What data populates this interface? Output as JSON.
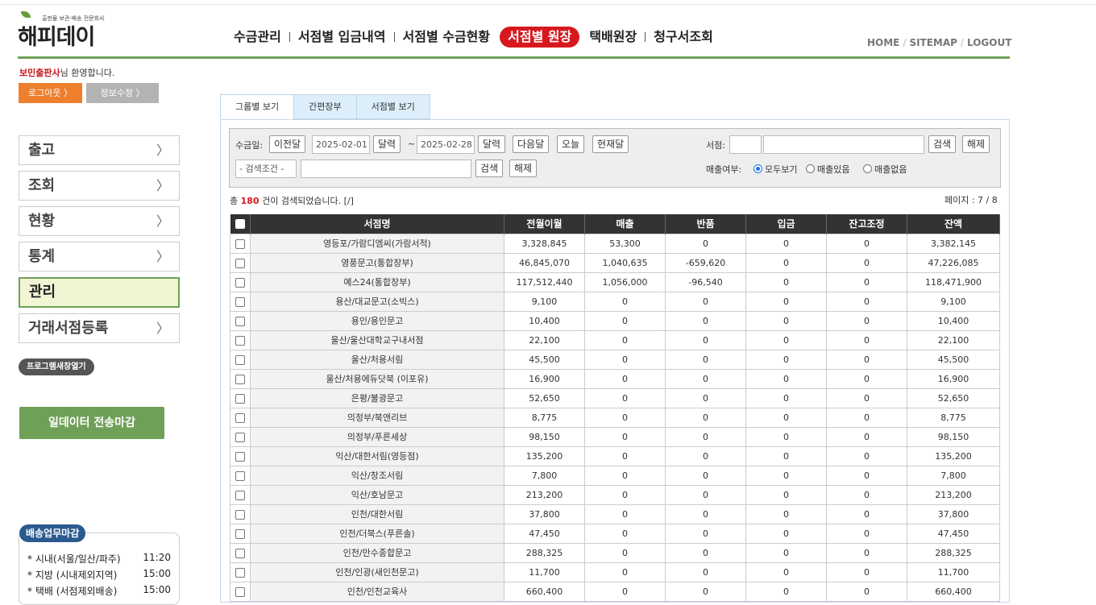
{
  "logo": {
    "subtitle": "출판물 보관·배송 전문회사",
    "name": "해피데이"
  },
  "nav": {
    "items": [
      "수금관리",
      "서점별 입금내역",
      "서점별 수금현황",
      "서점별 원장",
      "택배원장",
      "청구서조회"
    ],
    "active_index": 3
  },
  "util": {
    "home": "HOME",
    "sitemap": "SITEMAP",
    "logout": "LOGOUT"
  },
  "user": {
    "name": "보민출판사",
    "suffix": "님 환영합니다.",
    "logout_btn": "로그아웃 〉",
    "info_btn": "정보수정 〉"
  },
  "sidebar": {
    "items": [
      "출고",
      "조회",
      "현황",
      "통계",
      "관리",
      "거래서점등록"
    ],
    "active_index": 4,
    "program_btn": "프로그램새창열기",
    "close_btn": "일데이터 전송마감"
  },
  "shipping": {
    "title": "배송업무마감",
    "rows": [
      {
        "label": "* 시내(서울/일산/파주)",
        "time": "11:20"
      },
      {
        "label": "* 지방 (시내제외지역)",
        "time": "15:00"
      },
      {
        "label": "* 택배 (서점제외배송)",
        "time": "15:00"
      }
    ]
  },
  "tabs": [
    "그룹별 보기",
    "간편장부",
    "서점별 보기"
  ],
  "search": {
    "date_label": "수금일:",
    "prev_btn": "이전달",
    "from": "2025-02-01",
    "cal_btn": "달력",
    "tilde": "~",
    "to": "2025-02-28",
    "next_btn": "다음달",
    "today_btn": "오늘",
    "current_btn": "현재달",
    "store_label": "서점:",
    "search_btn": "검색",
    "reset_btn": "해제",
    "cond_label": "- 검색조건 -",
    "sales_label": "매출여부:",
    "radios": [
      "모두보기",
      "매출있음",
      "매출없음"
    ],
    "radio_selected": 0
  },
  "result": {
    "prefix": "총",
    "count": "180",
    "suffix": "건이 검색되었습니다. [/]",
    "page": "페이지 : 7 / 8"
  },
  "table": {
    "headers": [
      "서점명",
      "전월이월",
      "매출",
      "반품",
      "입금",
      "잔고조정",
      "잔액"
    ],
    "rows": [
      [
        "영등포/가람디엠씨(가람서적)",
        "3,328,845",
        "53,300",
        "0",
        "0",
        "0",
        "3,382,145"
      ],
      [
        "영풍문고(통합장부)",
        "46,845,070",
        "1,040,635",
        "-659,620",
        "0",
        "0",
        "47,226,085"
      ],
      [
        "예스24(통합장부)",
        "117,512,440",
        "1,056,000",
        "-96,540",
        "0",
        "0",
        "118,471,900"
      ],
      [
        "용산/대교문고(소빅스)",
        "9,100",
        "0",
        "0",
        "0",
        "0",
        "9,100"
      ],
      [
        "용인/용인문고",
        "10,400",
        "0",
        "0",
        "0",
        "0",
        "10,400"
      ],
      [
        "울산/울산대학교구내서점",
        "22,100",
        "0",
        "0",
        "0",
        "0",
        "22,100"
      ],
      [
        "울산/처용서림",
        "45,500",
        "0",
        "0",
        "0",
        "0",
        "45,500"
      ],
      [
        "울산/처용에듀닷북 (이포유)",
        "16,900",
        "0",
        "0",
        "0",
        "0",
        "16,900"
      ],
      [
        "은평/불광문고",
        "52,650",
        "0",
        "0",
        "0",
        "0",
        "52,650"
      ],
      [
        "의정부/북앤리브",
        "8,775",
        "0",
        "0",
        "0",
        "0",
        "8,775"
      ],
      [
        "의정부/푸른세상",
        "98,150",
        "0",
        "0",
        "0",
        "0",
        "98,150"
      ],
      [
        "익산/대한서림(영등점)",
        "135,200",
        "0",
        "0",
        "0",
        "0",
        "135,200"
      ],
      [
        "익산/창조서림",
        "7,800",
        "0",
        "0",
        "0",
        "0",
        "7,800"
      ],
      [
        "익산/호남문고",
        "213,200",
        "0",
        "0",
        "0",
        "0",
        "213,200"
      ],
      [
        "인천/대한서림",
        "37,800",
        "0",
        "0",
        "0",
        "0",
        "37,800"
      ],
      [
        "인천/더북스(푸른솔)",
        "47,450",
        "0",
        "0",
        "0",
        "0",
        "47,450"
      ],
      [
        "인천/만수종합문고",
        "288,325",
        "0",
        "0",
        "0",
        "0",
        "288,325"
      ],
      [
        "인천/인광(새인천문고)",
        "11,700",
        "0",
        "0",
        "0",
        "0",
        "11,700"
      ],
      [
        "인천/인천교육사",
        "660,400",
        "0",
        "0",
        "0",
        "0",
        "660,400"
      ]
    ]
  }
}
